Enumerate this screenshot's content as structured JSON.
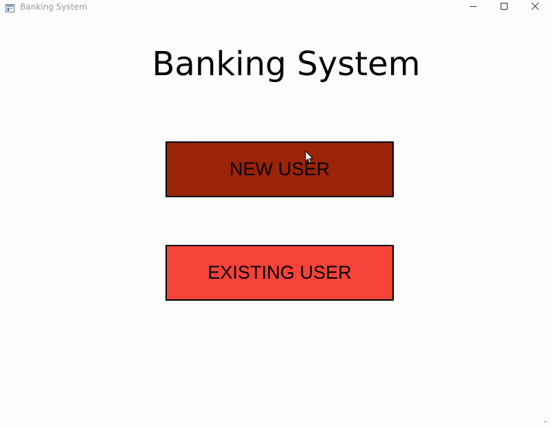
{
  "window": {
    "title": "Banking System",
    "app_icon": "window-app-icon",
    "controls": [
      "minimize-icon",
      "maximize-icon",
      "close-icon"
    ]
  },
  "main": {
    "heading": "Banking System",
    "buttons": [
      {
        "label": "NEW USER",
        "color": "#9b2307",
        "state": "hover"
      },
      {
        "label": "EXISTING USER",
        "color": "#f5433a",
        "state": "normal"
      }
    ]
  },
  "colors": {
    "background": "#fdfdfb",
    "text": "#000000"
  },
  "misc": {
    "resize_grip": "^"
  }
}
